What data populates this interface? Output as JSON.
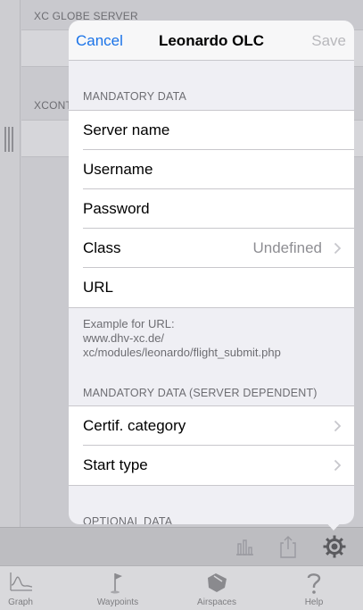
{
  "background": {
    "section1_header": "XC GLOBE SERVER",
    "section2_header": "XCONT"
  },
  "popover": {
    "cancel_label": "Cancel",
    "title": "Leonardo OLC",
    "save_label": "Save",
    "mandatory_header": "MANDATORY DATA",
    "mandatory_rows": {
      "server_name": "Server name",
      "username": "Username",
      "password": "Password",
      "class_label": "Class",
      "class_value": "Undefined",
      "url": "URL"
    },
    "url_example_line1": "Example for URL:",
    "url_example_line2": "www.dhv-xc.de/",
    "url_example_line3": "xc/modules/leonardo/flight_submit.php",
    "server_dependent_header": "MANDATORY DATA (SERVER DEPENDENT)",
    "server_rows": {
      "certif_category": "Certif. category",
      "start_type": "Start type"
    },
    "optional_header": "OPTIONAL DATA"
  },
  "tabs": [
    {
      "label": "Graph",
      "icon": "graph-icon"
    },
    {
      "label": "Waypoints",
      "icon": "flag-icon"
    },
    {
      "label": "Airspaces",
      "icon": "map-icon"
    },
    {
      "label": "Help",
      "icon": "question-icon"
    }
  ],
  "colors": {
    "accent": "#1a73e8",
    "disabled": "#b8b8bc"
  }
}
